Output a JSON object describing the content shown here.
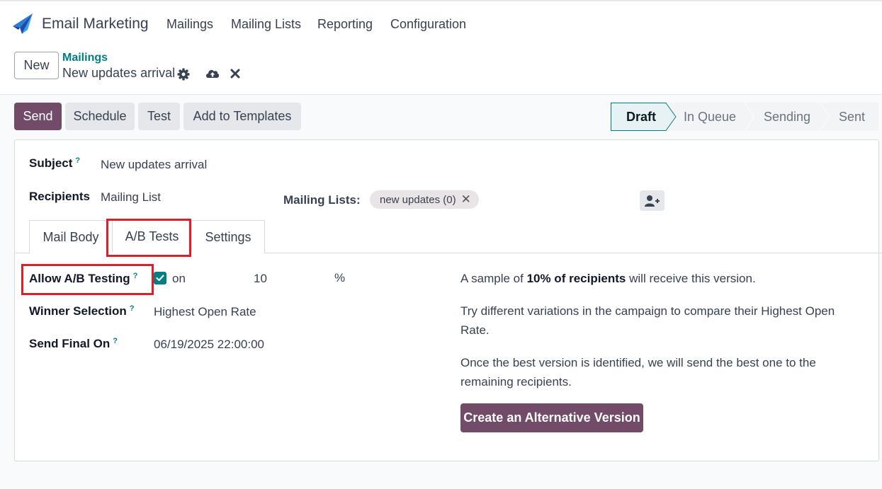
{
  "app": {
    "title": "Email Marketing"
  },
  "menu": [
    {
      "label": "Mailings"
    },
    {
      "label": "Mailing Lists"
    },
    {
      "label": "Reporting"
    },
    {
      "label": "Configuration"
    }
  ],
  "control_panel": {
    "new_label": "New",
    "breadcrumb": "Mailings",
    "record_name": "New updates arrival"
  },
  "actions": {
    "send": "Send",
    "schedule": "Schedule",
    "test": "Test",
    "add_to_templates": "Add to Templates"
  },
  "status": {
    "current": "Draft",
    "stages": [
      "Draft",
      "In Queue",
      "Sending",
      "Sent"
    ]
  },
  "form": {
    "subject_label": "Subject",
    "subject_value": "New updates arrival",
    "recipients_label": "Recipients",
    "recipients_value": "Mailing List",
    "mailing_lists_label": "Mailing Lists:",
    "mailing_list_tag": "new updates (0)",
    "help_marker": "?"
  },
  "tabs": [
    {
      "label": "Mail Body"
    },
    {
      "label": "A/B Tests"
    },
    {
      "label": "Settings"
    }
  ],
  "ab": {
    "allow_label": "Allow A/B Testing",
    "allow_checked_label": "on",
    "percent_value": "10",
    "percent_symbol": "%",
    "winner_label": "Winner Selection",
    "winner_value": "Highest Open Rate",
    "send_final_label": "Send Final On",
    "send_final_value": "06/19/2025 22:00:00",
    "info_sample_prefix": "A sample of ",
    "info_sample_bold": "10% of recipients",
    "info_sample_suffix": " will receive this version.",
    "info_variations": "Try different variations in the campaign to compare their Highest Open Rate.",
    "info_best": "Once the best version is identified, we will send the best one to the remaining recipients.",
    "create_alt_label": "Create an Alternative Version"
  },
  "colors": {
    "primary": "#714b67",
    "link": "#017e84",
    "highlight": "#e01e2b"
  }
}
